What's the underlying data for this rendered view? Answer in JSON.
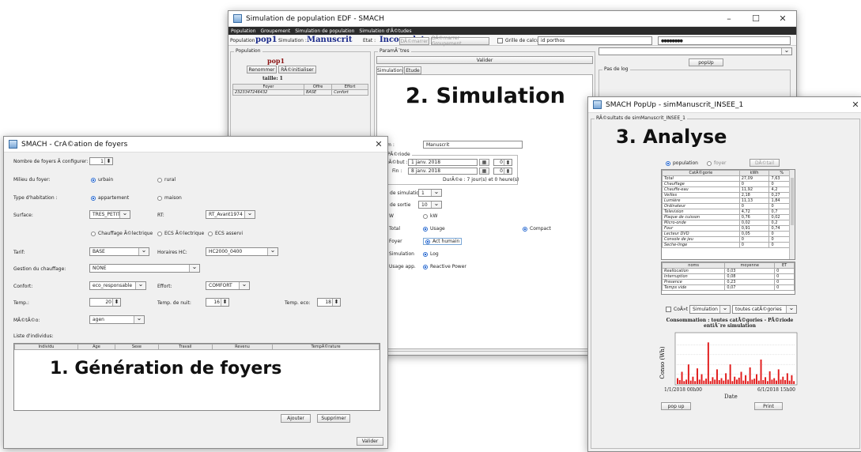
{
  "sim_window": {
    "title": "Simulation de population EDF - SMACH",
    "menu": [
      "Population",
      "Groupement",
      "Simulation de population",
      "Simulation d'Ã©tudes"
    ],
    "toolbar": {
      "population_label": "Population :",
      "population_value": "pop1",
      "simulation_label": "Simulation :",
      "simulation_value": "Manuscrit",
      "etat_label": "Etat :",
      "etat_value": "Incomplet",
      "demarrer": "DÃ©marrer",
      "demarrer_groupement": "DÃ©marrer Groupement",
      "grille_label": "Grille de calcul",
      "grille_value": "id porthos",
      "password": "●●●●●●●●"
    },
    "population_panel": {
      "caption": "Population",
      "name": "pop1",
      "renommer": "Renommer",
      "reinitialiser": "RÃ©initialiser",
      "taille": "taille: 1",
      "columns": [
        "Foyer",
        "Offre",
        "Effort"
      ],
      "rows": [
        [
          "2323347246432",
          "BASE",
          "Confort"
        ]
      ]
    },
    "params_caption": "ParamÃ¨tres",
    "valider": "Valider",
    "tabs": [
      "Simulation",
      "Etude"
    ],
    "popup_btn": "popUp",
    "pas_de_log": "Pas de log",
    "overlay": "2. Simulation",
    "form": {
      "nom_label": "Nom :",
      "nom_value": "Manuscrit",
      "periode_caption": "PÃ©riode",
      "debut_label": "DÃ©but :",
      "debut_value": "1 janv. 2018",
      "debut_h": "0",
      "fin_label": "Fin :",
      "fin_value": "8 janv. 2018",
      "fin_h": "0",
      "duree": "DurÃ©e : 7 jour(s) et 0 heure(s)",
      "pas_sim_label": "Pas de simulation",
      "pas_sim_value": "1",
      "pas_sortie_label": "Pas de sortie",
      "pas_sortie_value": "10",
      "unit_w": "W",
      "unit_kw": "kW",
      "options": [
        "Total",
        "Usage",
        "Compact",
        "Foyer",
        "Act humain",
        "Simulation",
        "Log",
        "Usage app.",
        "Reactive Power"
      ]
    }
  },
  "foyers_window": {
    "title": "SMACH - CrÃ©ation de foyers",
    "close": "✕",
    "nb_label": "Nombre de foyers Ã  configurer:",
    "nb_value": "1",
    "milieu_label": "Milieu du foyer:",
    "milieu_opts": [
      "urbain",
      "rural"
    ],
    "type_label": "Type d'habitation :",
    "type_opts": [
      "appartement",
      "maison"
    ],
    "surface_label": "Surface:",
    "surface_value": "TRES_PETIT",
    "rt_label": "RT:",
    "rt_value": "RT_Avant1974",
    "chauffage_opts": [
      "Chauffage Ã©lectrique",
      "ECS Ã©lectrique",
      "ECS asservi"
    ],
    "tarif_label": "Tarif:",
    "tarif_value": "BASE",
    "horaires_label": "Horaires HC:",
    "horaires_value": "HC2000_0400",
    "gestion_label": "Gestion du chauffage:",
    "gestion_value": "NONE",
    "confort_label": "Confort:",
    "confort_value": "eco_responsable",
    "effort_label": "Effort:",
    "effort_value": "COMFORT",
    "temp_label": "Temp.:",
    "temp_value": "20",
    "temp_nuit_label": "Temp. de nuit:",
    "temp_nuit_value": "16",
    "temp_eco_label": "Temp. eco:",
    "temp_eco_value": "18",
    "meteo_label": "MÃ©tÃ©o:",
    "meteo_value": "agen",
    "liste_label": "Liste d'individus:",
    "columns": [
      "Individu",
      "Age",
      "Sexe",
      "Travail",
      "Revenu",
      "TempÃ©rature"
    ],
    "overlay": "1. Génération de foyers",
    "ajouter": "Ajouter",
    "supprimer": "Supprimer",
    "valider": "Valider"
  },
  "popup_window": {
    "title": "SMACH PopUp - simManuscrit_INSEE_1",
    "close": "✕",
    "results_caption": "RÃ©sultats de simManuscrit_INSEE_1",
    "overlay": "3. Analyse",
    "radio_population": "population",
    "radio_foyer": "foyer",
    "detail_btn": "DÃ©tail",
    "columns": [
      "CatÃ©gorie",
      "kWh",
      "%"
    ],
    "rows": [
      [
        "Total",
        "27,09",
        "7,63"
      ],
      [
        "Chauffage",
        "0",
        "0"
      ],
      [
        "Chauffe-eau",
        "11,92",
        "4,2"
      ],
      [
        "Veilles",
        "2,18",
        "0,27"
      ],
      [
        "Lumière",
        "11,13",
        "1,84"
      ],
      [
        "Ordinateur",
        "0",
        "0"
      ],
      [
        "Television",
        "4,72",
        "0,7"
      ],
      [
        "Plaque de cuisson",
        "0,76",
        "0,02"
      ],
      [
        "Micro-onde",
        "0,02",
        "0,2"
      ],
      [
        "Four",
        "0,91",
        "0,74"
      ],
      [
        "Lecteur DVD",
        "0,05",
        "0"
      ],
      [
        "Console de jeu",
        "0",
        "0"
      ],
      [
        "Seche-linge",
        "0",
        "0"
      ]
    ],
    "columns2": [
      "noms",
      "moyenne",
      "ET"
    ],
    "rows2": [
      [
        "Reallocation",
        "0,03",
        "0"
      ],
      [
        "Interruption",
        "0,08",
        "0"
      ],
      [
        "Presence",
        "0,23",
        "0"
      ],
      [
        "Temps vide",
        "0,07",
        "0"
      ]
    ],
    "cout_label": "CoÃ»t",
    "sim_select": "Simulation",
    "cat_select": "toutes catÃ©gories",
    "chart_title": "Consommation : toutes catÃ©gories - PÃ©riode entiÃ¨re simulation",
    "chart_ylabel": "Conso (Wh)",
    "chart_xstart": "1/1/2018 00h00",
    "chart_xend": "6/1/2018 15h00",
    "chart_xlabel": "Date",
    "popup_btn": "pop up",
    "print_btn": "Print",
    "bar_color": "#e11b1b"
  },
  "chart_data": {
    "type": "bar",
    "title": "Consommation : toutes catÃ©gories - PÃ©riode entiÃ¨re simulation",
    "xlabel": "Date",
    "ylabel": "Conso (Wh)",
    "ylim": [
      0,
      1000
    ],
    "values": [
      120,
      80,
      250,
      60,
      90,
      400,
      70,
      150,
      60,
      320,
      90,
      200,
      70,
      110,
      850,
      60,
      140,
      90,
      300,
      80,
      120,
      70,
      220,
      90,
      400,
      60,
      150,
      90,
      130,
      250,
      70,
      180,
      60,
      340,
      90,
      110,
      200,
      70,
      500,
      80,
      140,
      60,
      260,
      90,
      120,
      70,
      300,
      90,
      150,
      80,
      220,
      70,
      180,
      60
    ]
  }
}
